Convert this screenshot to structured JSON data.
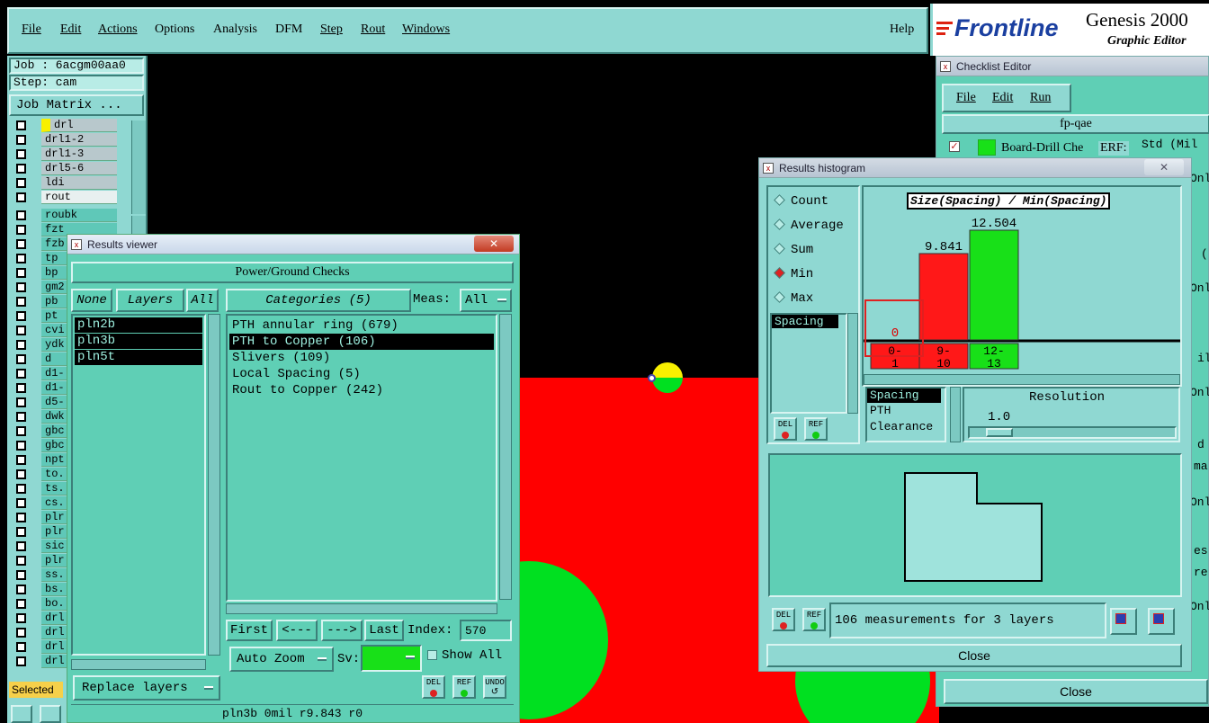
{
  "menu": {
    "items": [
      "File",
      "Edit",
      "Actions",
      "Options",
      "Analysis",
      "DFM",
      "Step",
      "Rout",
      "Windows"
    ],
    "help": "Help"
  },
  "brand": {
    "logo": "Frontline",
    "product": "Genesis 2000",
    "subtitle": "Graphic Editor"
  },
  "job_panel": {
    "job": "Job : 6acgm00aa0",
    "step": "Step: cam",
    "matrix_button": "Job Matrix ..."
  },
  "layers_top": [
    "drl",
    "drl1-2",
    "drl1-3",
    "drl5-6",
    "ldi",
    "rout"
  ],
  "layers_bottom": [
    "roubk",
    "fzt",
    "fzb",
    "tp",
    "bp",
    "gm2",
    "pb",
    "pt",
    "cvi",
    "ydk",
    "d",
    "d1-",
    "d1-",
    "d5-",
    "dwk",
    "gbc",
    "gbc",
    "npt",
    "to.",
    "ts.",
    "cs.",
    "plr",
    "plr",
    "sic",
    "plr",
    "ss.",
    "bs.",
    "bo.",
    "drl",
    "drl",
    "drl",
    "drl"
  ],
  "selected_label": "Selected",
  "colors": {
    "panel": "#8fd8d2",
    "panel_dark": "#5fcfb5",
    "board_red": "#ff0000",
    "pad_green": "#00e020",
    "highlight_yellow": "#f8f000"
  },
  "results_viewer": {
    "title": "Results viewer",
    "header": "Power/Ground Checks",
    "none_btn": "None",
    "layers_btn": "Layers",
    "all_btn": "All",
    "layers": [
      "pln2b",
      "pln3b",
      "pln5t"
    ],
    "categories_btn": "Categories (5)",
    "meas_label": "Meas:",
    "meas_value": "All",
    "categories": [
      "PTH annular ring (679)",
      "PTH to Copper (106)",
      "Slivers (109)",
      "Local Spacing (5)",
      "Rout to Copper (242)"
    ],
    "first_btn": "First",
    "prev_btn": "<---",
    "next_btn": "--->",
    "last_btn": "Last",
    "index_label": "Index:",
    "index_value": "570",
    "auto_zoom": "Auto Zoom",
    "sv_label": "Sv:",
    "show_all": "Show All",
    "replace_layers": "Replace layers",
    "del": "DEL",
    "ref": "REF",
    "undo": "UNDO",
    "status": "pln3b 0mil  r9.843  r0"
  },
  "checklist_editor": {
    "title": "Checklist Editor",
    "menu": [
      "File",
      "Edit",
      "Run"
    ],
    "checklist": "fp-qae",
    "action_name": "Board-Drill Che",
    "erf_label": "ERF:",
    "erf_value": "Std (Mil",
    "side_texts": [
      "Onl",
      "(",
      "Onl",
      "",
      "il",
      "Onl",
      "d",
      "ma",
      "Onl",
      "es",
      "re",
      "Onl"
    ],
    "close": "Close"
  },
  "histogram": {
    "title": "Results histogram",
    "options": [
      "Count",
      "Average",
      "Sum",
      "Min",
      "Max"
    ],
    "selected_option": "Min",
    "list_item": "Spacing",
    "chart_title": "Size(Spacing) / Min(Spacing)",
    "resolution_label": "Resolution",
    "resolution_value": "1.0",
    "measure_list": [
      "Spacing",
      "PTH",
      "Clearance"
    ],
    "summary": "106 measurements for 3 layers",
    "close": "Close",
    "del": "DEL",
    "ref": "REF"
  },
  "chart_data": {
    "type": "bar",
    "title": "Size(Spacing) / Min(Spacing)",
    "categories": [
      "0-1",
      "9-10",
      "12-13"
    ],
    "values": [
      0,
      9.841,
      12.504
    ],
    "value_labels": [
      "0",
      "9.841",
      "12.504"
    ],
    "bar_colors": [
      "#ff1818",
      "#ff1818",
      "#18e018"
    ],
    "ylim": [
      0,
      12.504
    ]
  }
}
